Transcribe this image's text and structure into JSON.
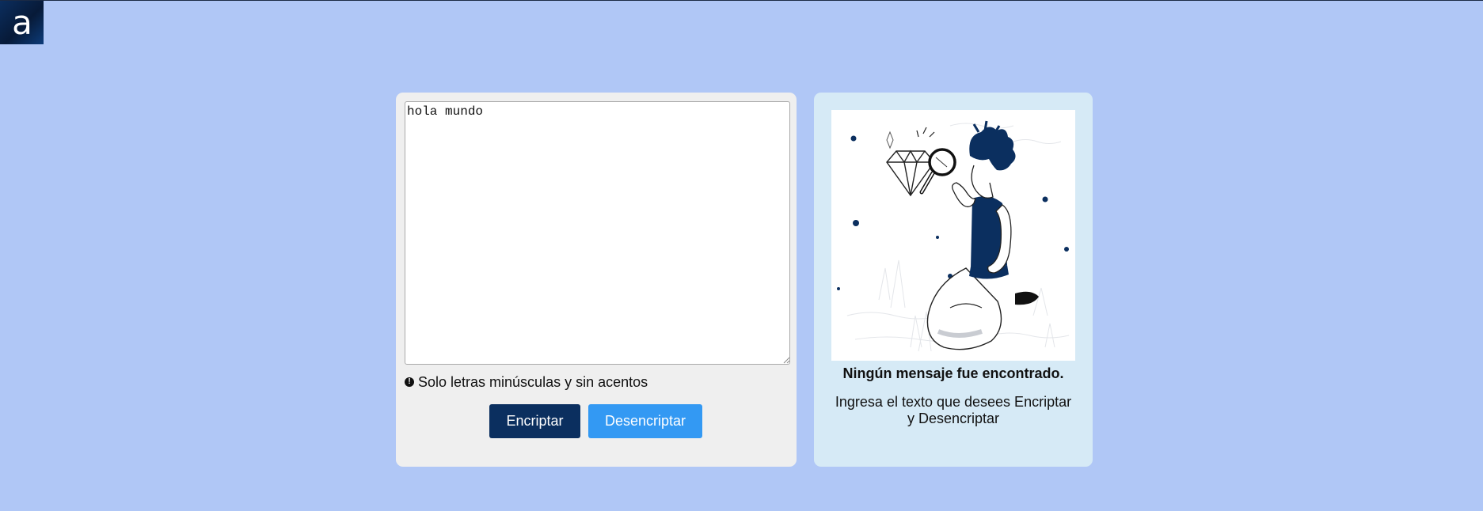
{
  "brand": {
    "logo_icon": "alura-a-logo",
    "logo_letter": "a",
    "accent_color": "#0b2f5f"
  },
  "input": {
    "value": "hola mundo",
    "hint_icon": "info-circle-icon",
    "hint_text": "Solo letras minúsculas y sin acentos"
  },
  "buttons": {
    "encrypt_label": "Encriptar",
    "encrypt_color": "#0b2f5f",
    "decrypt_label": "Desencriptar",
    "decrypt_color": "#3399f3"
  },
  "output": {
    "illustration_icon": "person-with-magnifier-illustration",
    "title": "Ningún mensaje fue encontrado.",
    "body": "Ingresa el texto que desees Encriptar y Desencriptar"
  },
  "colors": {
    "page_background": "#b0c7f6",
    "left_card_background": "#efefef",
    "right_card_background": "#d6eaf6"
  }
}
